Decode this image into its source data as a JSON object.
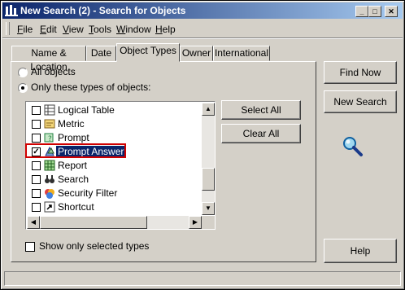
{
  "window": {
    "title": "New Search (2) - Search for Objects"
  },
  "title_buttons": {
    "minimize": "_",
    "maximize": "□",
    "close": "✕"
  },
  "menu": [
    {
      "label": "File",
      "key": "F"
    },
    {
      "label": "Edit",
      "key": "E"
    },
    {
      "label": "View",
      "key": "V"
    },
    {
      "label": "Tools",
      "key": "T"
    },
    {
      "label": "Window",
      "key": "W"
    },
    {
      "label": "Help",
      "key": "H"
    }
  ],
  "tabs": [
    "Name & Location",
    "Date",
    "Object Types",
    "Owner",
    "International"
  ],
  "active_tab": "Object Types",
  "options": {
    "all_objects": "All objects",
    "only_types": "Only these types of objects:",
    "selected": "only_types"
  },
  "object_types": [
    {
      "label": "Logical Table",
      "checked": false,
      "icon": "logical-table-icon"
    },
    {
      "label": "Metric",
      "checked": false,
      "icon": "metric-icon"
    },
    {
      "label": "Prompt",
      "checked": false,
      "icon": "prompt-icon"
    },
    {
      "label": "Prompt Answer",
      "checked": true,
      "icon": "prompt-answer-icon",
      "selected": true
    },
    {
      "label": "Report",
      "checked": false,
      "icon": "report-icon"
    },
    {
      "label": "Search",
      "checked": false,
      "icon": "search-binoculars-icon"
    },
    {
      "label": "Security Filter",
      "checked": false,
      "icon": "security-filter-icon"
    },
    {
      "label": "Shortcut",
      "checked": false,
      "icon": "shortcut-icon"
    }
  ],
  "buttons": {
    "select_all": "Select All",
    "clear_all": "Clear All",
    "find_now": "Find Now",
    "new_search": "New Search",
    "help": "Help"
  },
  "show_selected": {
    "label": "Show only selected types",
    "checked": false
  },
  "colors": {
    "title_start": "#0a246a",
    "title_end": "#a6caf0",
    "selection": "#0a246a",
    "highlight_border": "#d00000"
  }
}
